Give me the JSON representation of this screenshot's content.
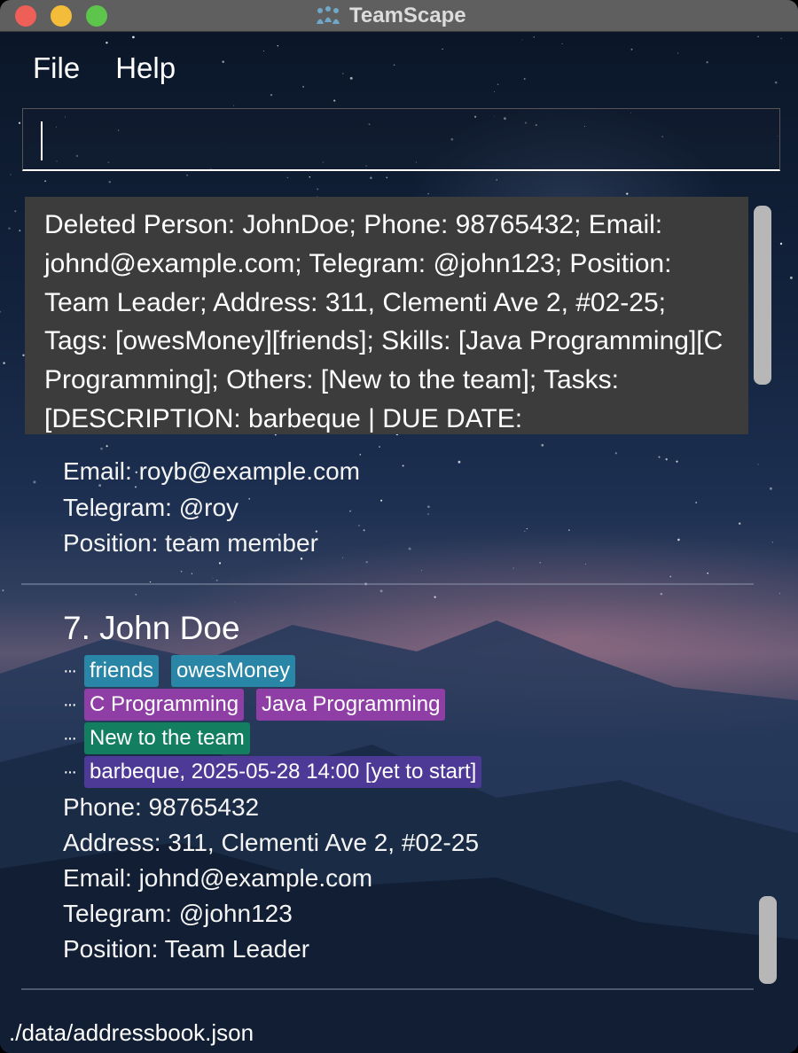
{
  "window": {
    "title": "TeamScape"
  },
  "menu": {
    "file": "File",
    "help": "Help"
  },
  "command": {
    "value": ""
  },
  "result": {
    "text": "Deleted Person: JohnDoe; Phone: 98765432; Email: johnd@example.com; Telegram: @john123; Position: Team Leader; Address: 311, Clementi Ave 2, #02-25; Tags: [owesMoney][friends]; Skills: [Java Programming][C Programming]; Others: [New to the team]; Tasks: [DESCRIPTION: barbeque | DUE DATE:"
  },
  "previous_card": {
    "email": "Email: royb@example.com",
    "telegram": "Telegram: @roy",
    "position": "Position: team member"
  },
  "card": {
    "name": "7.  John Doe",
    "tags": [
      "friends",
      "owesMoney"
    ],
    "skills": [
      "C Programming",
      "Java Programming"
    ],
    "others": [
      "New to the team"
    ],
    "tasks": [
      "barbeque, 2025-05-28 14:00 [yet to start]"
    ],
    "phone": "Phone: 98765432",
    "address": "Address: 311, Clementi Ave 2, #02-25",
    "email": "Email: johnd@example.com",
    "telegram": "Telegram: @john123",
    "position": "Position: Team Leader"
  },
  "status": {
    "path": "./data/addressbook.json"
  },
  "colors": {
    "tag": "#2a86a6",
    "skill": "#8f3ea6",
    "other": "#137e60",
    "task": "#4d3a96",
    "close": "#ee5f58",
    "minimize": "#f3bd3a",
    "zoom": "#5ec54c"
  }
}
